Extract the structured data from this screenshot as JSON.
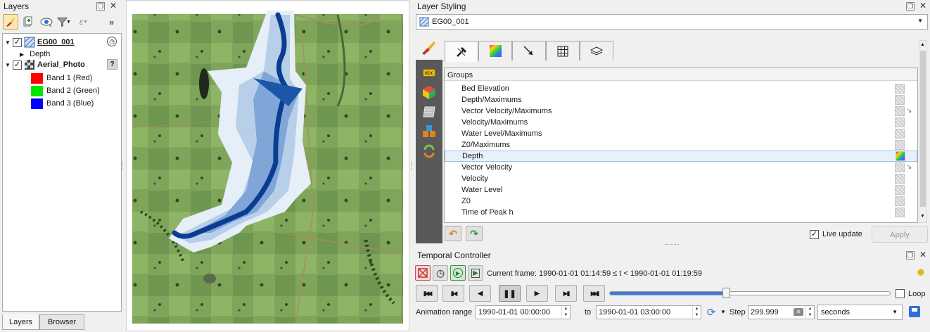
{
  "layers_panel": {
    "title": "Layers",
    "tree": [
      {
        "name": "EG00_001",
        "checked": true,
        "type": "mesh",
        "bold_underline": true
      },
      {
        "name": "Depth",
        "child": true
      },
      {
        "name": "Aerial_Photo",
        "checked": true,
        "type": "raster",
        "bold": true
      },
      {
        "name": "Band 1 (Red)",
        "color": "#ff0000"
      },
      {
        "name": "Band 2 (Green)",
        "color": "#00e600"
      },
      {
        "name": "Band 3 (Blue)",
        "color": "#0000ff"
      }
    ],
    "bottom_tabs": [
      "Layers",
      "Browser"
    ],
    "expand_label": "»"
  },
  "styling_panel": {
    "title": "Layer Styling",
    "layer_combo": "EG00_001",
    "groups_header": "Groups",
    "groups": [
      {
        "name": "Bed Elevation",
        "vector": false,
        "active": false
      },
      {
        "name": "Depth/Maximums",
        "vector": false,
        "active": false
      },
      {
        "name": "Vector Velocity/Maximums",
        "vector": true,
        "active": false
      },
      {
        "name": "Velocity/Maximums",
        "vector": false,
        "active": false
      },
      {
        "name": "Water Level/Maximums",
        "vector": false,
        "active": false
      },
      {
        "name": "Z0/Maximums",
        "vector": false,
        "active": false
      },
      {
        "name": "Depth",
        "vector": false,
        "active": true
      },
      {
        "name": "Vector Velocity",
        "vector": true,
        "active": false
      },
      {
        "name": "Velocity",
        "vector": false,
        "active": false
      },
      {
        "name": "Water Level",
        "vector": false,
        "active": false
      },
      {
        "name": "Z0",
        "vector": false,
        "active": false
      },
      {
        "name": "Time of Peak h",
        "vector": false,
        "active": false
      }
    ],
    "live_update_label": "Live update",
    "live_update_checked": true,
    "apply_label": "Apply",
    "side_abc": "abc"
  },
  "temporal": {
    "title": "Temporal Controller",
    "current_frame": "Current frame: 1990-01-01 01:14:59 ≤ t < 1990-01-01 01:19:59",
    "slider_fraction": 0.415,
    "loop_label": "Loop",
    "range_label": "Animation range",
    "range_start": "1990-01-01 00:00:00",
    "to_label": "to",
    "range_end": "1990-01-01 03:00:00",
    "step_label": "Step",
    "step_value": "299.999",
    "step_unit": "seconds"
  },
  "colors": {
    "accent_selected": "#e8f1fb",
    "sidebar": "#595959",
    "water_dark": "#0a3d91",
    "water_light": "#e6eef8"
  }
}
